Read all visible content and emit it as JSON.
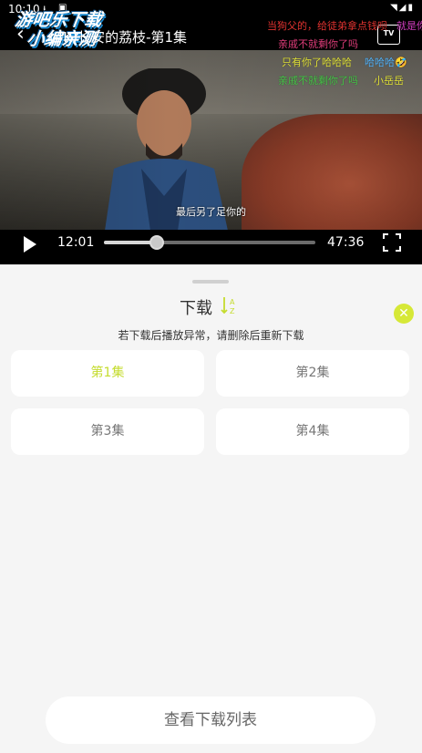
{
  "status_bar": {
    "time": "10:10",
    "icons": [
      "download-icon",
      "a-icon",
      "wifi-icon",
      "signal-icon",
      "battery-icon"
    ]
  },
  "watermark": {
    "line1": "游吧乐下载",
    "line2": "小编亲测"
  },
  "player": {
    "title": "(4K)长安的荔枝-第1集",
    "current_time": "12:01",
    "duration": "47:36",
    "progress": 0.25,
    "subtitle": "最后另了足你的",
    "tv_label": "TV",
    "danmaku": [
      {
        "text": "当狗父的，给徒弟拿点钱呗",
        "color": "#e0322f"
      },
      {
        "text": "就是你",
        "color": "#d13cbf"
      },
      {
        "text": "亲戚不就剩你了吗",
        "color": "#e03d7a"
      },
      {
        "text": "只有你了哈哈哈",
        "color": "#e3e33a"
      },
      {
        "text": "哈哈哈🤣",
        "color": "#55b7ff"
      },
      {
        "text": "亲戚不就剩你了吗",
        "color": "#48c94a"
      },
      {
        "text": "小岳岳",
        "color": "#e3e33a"
      }
    ]
  },
  "download": {
    "title": "下载",
    "notice": "若下载后播放异常，请删除后重新下载",
    "episodes": [
      {
        "label": "第1集",
        "active": true
      },
      {
        "label": "第2集",
        "active": false
      },
      {
        "label": "第3集",
        "active": false
      },
      {
        "label": "第4集",
        "active": false
      }
    ],
    "view_list_label": "查看下载列表",
    "accent_color": "#c5dc2f"
  }
}
